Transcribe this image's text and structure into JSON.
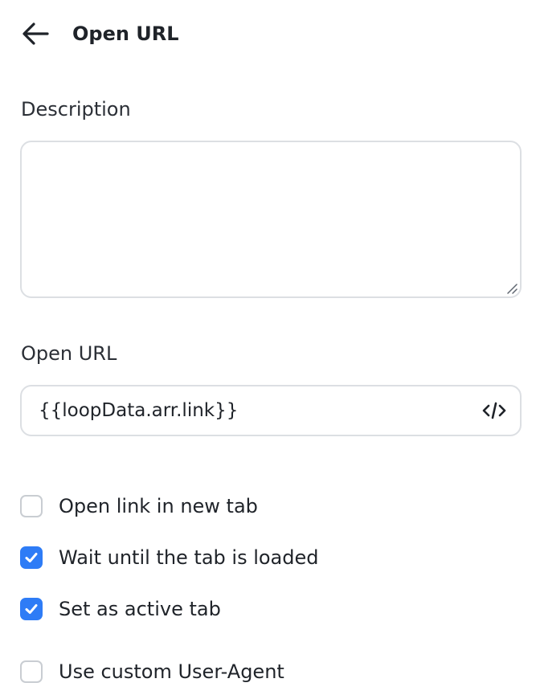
{
  "header": {
    "back_icon": "arrow-left-icon",
    "title": "Open URL"
  },
  "description": {
    "label": "Description",
    "value": "",
    "placeholder": ""
  },
  "open_url": {
    "label": "Open URL",
    "value": "{{loopData.arr.link}}",
    "code_icon": "code-icon"
  },
  "options": {
    "new_tab": {
      "label": "Open link in new tab",
      "checked": false
    },
    "wait_loaded": {
      "label": "Wait until the tab is loaded",
      "checked": true
    },
    "active_tab": {
      "label": "Set as active tab",
      "checked": true
    },
    "custom_user_agent": {
      "label": "Use custom User-Agent",
      "checked": false
    }
  },
  "colors": {
    "accent": "#2e7cf6",
    "border": "#dcdfe3",
    "text": "#1f2329"
  }
}
